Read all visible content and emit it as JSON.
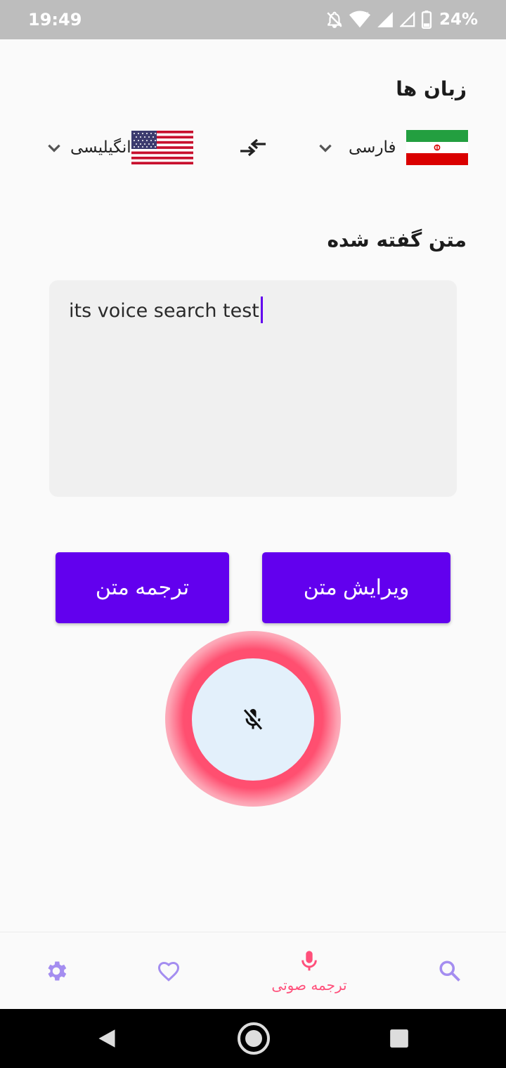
{
  "status_bar": {
    "time": "19:49",
    "battery": "24%",
    "icons": [
      "notifications-off-icon",
      "wifi-icon",
      "signal-icon",
      "signal-icon",
      "battery-icon"
    ]
  },
  "languages": {
    "title": "زبان ها",
    "source": {
      "label": "فارسی",
      "flag": "iran-flag-icon"
    },
    "target": {
      "label": "انگیلیسی",
      "flag": "usa-flag-icon"
    },
    "swap_icon": "swap-icon"
  },
  "spoken": {
    "title": "متن گفته شده",
    "text": "its voice search test"
  },
  "actions": {
    "edit_label": "ویرایش متن",
    "translate_label": "ترجمه متن"
  },
  "mic": {
    "icon": "mic-off-icon",
    "state": "listening"
  },
  "bottom_nav": {
    "items": [
      {
        "icon": "search-icon"
      },
      {
        "icon": "mic-icon",
        "label": "ترجمه صوتی",
        "active": true
      },
      {
        "icon": "heart-icon"
      },
      {
        "icon": "settings-icon"
      }
    ]
  },
  "colors": {
    "accent": "#6200ee",
    "active_nav": "#ff4f7a",
    "inactive_nav": "#a48df0",
    "mic_glow": "#ff4669",
    "text_box_bg": "#f0f0f0"
  }
}
